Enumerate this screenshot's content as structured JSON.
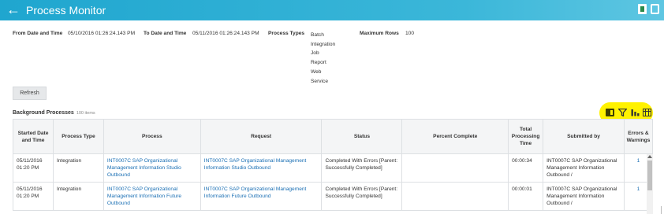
{
  "header": {
    "title": "Process Monitor",
    "back_icon": "arrow-left-icon",
    "icons": [
      "excel-export-icon",
      "print-icon"
    ]
  },
  "filters": {
    "from_label": "From Date and Time",
    "from_value": "05/10/2016 01:26:24.143 PM",
    "to_label": "To Date and Time",
    "to_value": "05/11/2016 01:26:24.143 PM",
    "types_label": "Process Types",
    "types": [
      "Batch",
      "Integration",
      "Job",
      "Report",
      "Web Service"
    ],
    "max_label": "Maximum Rows",
    "max_value": "100"
  },
  "refresh_label": "Refresh",
  "section": {
    "title": "Background Processes",
    "count": "100 items"
  },
  "toolbar_icons": [
    "excel-icon",
    "filter-icon",
    "chart-icon",
    "grid-icon"
  ],
  "table": {
    "headers": [
      "Started Date and Time",
      "Process Type",
      "Process",
      "Request",
      "Status",
      "Percent Complete",
      "Total Processing Time",
      "Submitted by",
      "Errors & Warnings"
    ],
    "rows": [
      {
        "started": "05/11/2016 01:20 PM",
        "type": "Integration",
        "process": "INT0007C SAP Organizational Management Information Studio Outbound",
        "request": "INT0007C SAP Organizational Management Information Studio Outbound",
        "status": "Completed With Errors [Parent: Successfully Completed]",
        "percent": "",
        "time": "00:00:34",
        "submitted": "INT0007C SAP Organizational Management Information Outbound /",
        "errors": "1"
      },
      {
        "started": "05/11/2016 01:20 PM",
        "type": "Integration",
        "process": "INT0007C SAP Organizational Management Information Future Outbound",
        "request": "INT0007C SAP Organizational Management Information Future Outbound",
        "status": "Completed With Errors [Parent: Successfully Completed]",
        "percent": "",
        "time": "00:00:01",
        "submitted": "INT0007C SAP Organizational Management Information Outbound /",
        "errors": "1"
      }
    ]
  },
  "colors": {
    "header": "#1fa6cf",
    "link": "#1a6fb4",
    "highlight": "#fff200"
  }
}
